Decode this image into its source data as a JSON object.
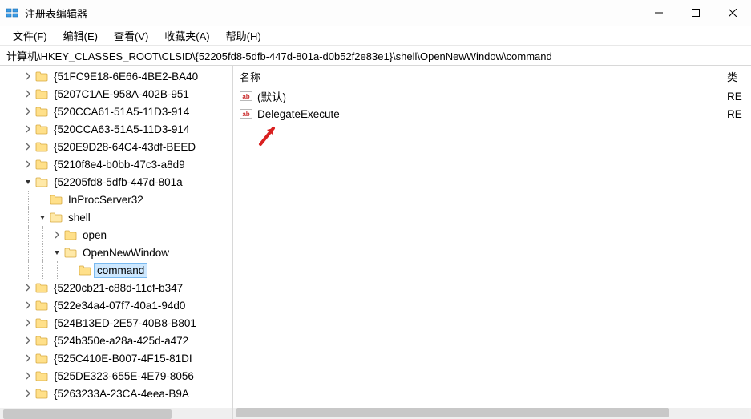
{
  "window": {
    "title": "注册表编辑器"
  },
  "menu": {
    "file": "文件(F)",
    "edit": "编辑(E)",
    "view": "查看(V)",
    "fav": "收藏夹(A)",
    "help": "帮助(H)"
  },
  "address": "计算机\\HKEY_CLASSES_ROOT\\CLSID\\{52205fd8-5dfb-447d-801a-d0b52f2e83e1}\\shell\\OpenNewWindow\\command",
  "tree": [
    {
      "depth": 1,
      "exp": "closed",
      "label": "{51FC9E18-6E66-4BE2-BA40"
    },
    {
      "depth": 1,
      "exp": "closed",
      "label": "{5207C1AE-958A-402B-951"
    },
    {
      "depth": 1,
      "exp": "closed",
      "label": "{520CCA61-51A5-11D3-914"
    },
    {
      "depth": 1,
      "exp": "closed",
      "label": "{520CCA63-51A5-11D3-914"
    },
    {
      "depth": 1,
      "exp": "closed",
      "label": "{520E9D28-64C4-43df-BEED"
    },
    {
      "depth": 1,
      "exp": "closed",
      "label": "{5210f8e4-b0bb-47c3-a8d9"
    },
    {
      "depth": 1,
      "exp": "open",
      "label": "{52205fd8-5dfb-447d-801a"
    },
    {
      "depth": 2,
      "exp": "none",
      "label": "InProcServer32"
    },
    {
      "depth": 2,
      "exp": "open",
      "label": "shell"
    },
    {
      "depth": 3,
      "exp": "closed",
      "label": "open"
    },
    {
      "depth": 3,
      "exp": "open",
      "label": "OpenNewWindow"
    },
    {
      "depth": 4,
      "exp": "none",
      "label": "command",
      "selected": true
    },
    {
      "depth": 1,
      "exp": "closed",
      "label": "{5220cb21-c88d-11cf-b347"
    },
    {
      "depth": 1,
      "exp": "closed",
      "label": "{522e34a4-07f7-40a1-94d0"
    },
    {
      "depth": 1,
      "exp": "closed",
      "label": "{524B13ED-2E57-40B8-B801"
    },
    {
      "depth": 1,
      "exp": "closed",
      "label": "{524b350e-a28a-425d-a472"
    },
    {
      "depth": 1,
      "exp": "closed",
      "label": "{525C410E-B007-4F15-81DI"
    },
    {
      "depth": 1,
      "exp": "closed",
      "label": "{525DE323-655E-4E79-8056"
    },
    {
      "depth": 1,
      "exp": "closed",
      "label": "{5263233A-23CA-4eea-B9A"
    }
  ],
  "list": {
    "col_name": "名称",
    "col_type": "类",
    "rows": [
      {
        "name": "(默认)",
        "type": "RE"
      },
      {
        "name": "DelegateExecute",
        "type": "RE"
      }
    ]
  }
}
